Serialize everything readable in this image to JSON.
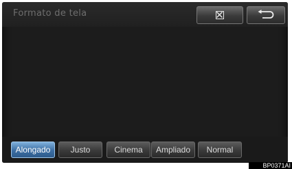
{
  "header": {
    "title": "Formato de tela",
    "close_icon": "close-box-icon",
    "back_icon": "return-arrow-icon"
  },
  "modes": [
    {
      "label": "Alongado",
      "selected": true
    },
    {
      "label": "Justo",
      "selected": false
    },
    {
      "label": "Cinema",
      "selected": false
    },
    {
      "label": "Ampliado",
      "selected": false
    },
    {
      "label": "Normal",
      "selected": false
    }
  ],
  "reference_code": "BP0371AI",
  "colors": {
    "screen_bg": "#1c1c1c",
    "selected_button": "#3c6ea3",
    "button": "#3a3a3a"
  }
}
